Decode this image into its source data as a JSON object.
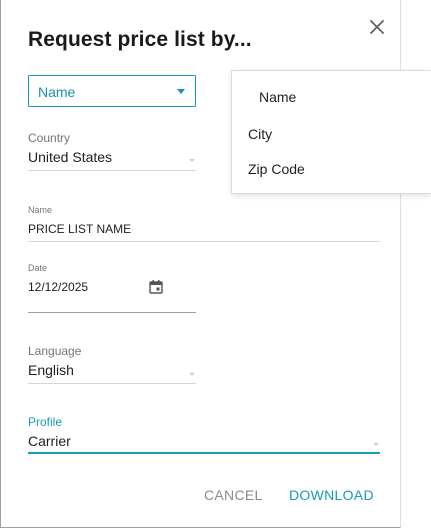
{
  "dialog": {
    "title": "Request price list by...",
    "close_icon": "close-icon"
  },
  "request_by": {
    "selected": "Name",
    "options": [
      "Name",
      "City",
      "Zip Code"
    ]
  },
  "fields": {
    "country": {
      "label": "Country",
      "value": "United States"
    },
    "name": {
      "label": "Name",
      "value": "PRICE LIST NAME"
    },
    "date": {
      "label": "Date",
      "value": "12/12/2025",
      "icon": "calendar-icon"
    },
    "language": {
      "label": "Language",
      "value": "English"
    },
    "profile": {
      "label": "Profile",
      "value": "Carrier"
    }
  },
  "actions": {
    "cancel_label": "CANCEL",
    "download_label": "DOWNLOAD"
  },
  "colors": {
    "accent": "#1a9bb5",
    "text": "#212121",
    "muted_label": "#757575",
    "cancel": "#8a8a8a"
  }
}
